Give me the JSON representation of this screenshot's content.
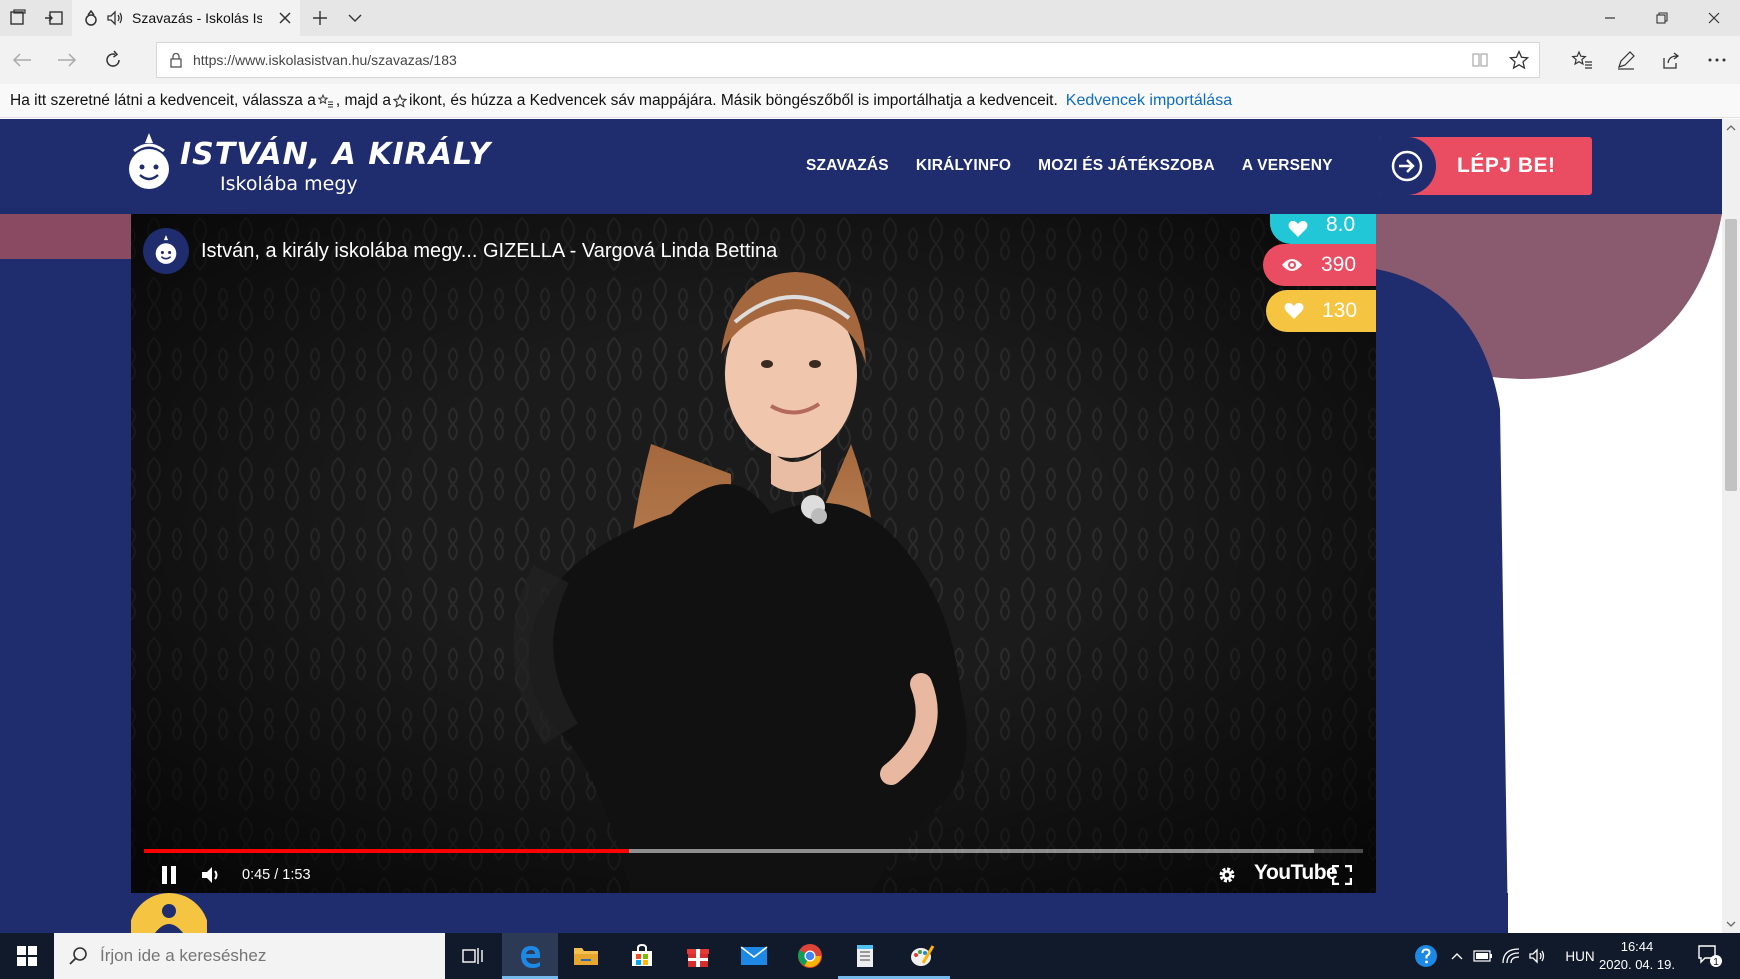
{
  "browser": {
    "tab_title": "Szavazás - Iskolás Is",
    "url": "https://www.iskolasistvan.hu/szavazas/183",
    "favorites_hint_a": "Ha itt szeretné látni a kedvenceit, válassza a ",
    "favorites_hint_b": " , majd a ",
    "favorites_hint_c": " ikont, és húzza a Kedvencek sáv mappájára. Másik böngészőből is importálhatja a kedvenceit.",
    "favorites_import_link": "Kedvencek importálása"
  },
  "site": {
    "logo_line1": "ISTVÁN, A KIRÁLY",
    "logo_line2": "Iskolába megy",
    "nav": [
      "SZAVAZÁS",
      "KIRÁLYINFO",
      "MOZI ÉS JÁTÉKSZOBA",
      "A VERSENY"
    ],
    "login_label": "LÉPJ BE!"
  },
  "video": {
    "title": "István, a király iskolába megy... GIZELLA - Vargová Linda Bettina",
    "time_current": "0:45",
    "time_total": "1:53",
    "time_readout": "0:45 / 1:53",
    "progress_fraction": 0.398,
    "buffer_fraction": 0.96,
    "brand_label": "YouTube"
  },
  "stats": {
    "rating": "8.0",
    "views": "390",
    "likes": "130"
  },
  "taskbar": {
    "search_placeholder": "Írjon ide a kereséshez",
    "language": "HUN",
    "time": "16:44",
    "date": "2020. 04. 19.",
    "notification_count": "1"
  },
  "colors": {
    "site_navy": "#1f2c6d",
    "login_red": "#ea4d62",
    "rating_cyan": "#22c7d7",
    "likes_yellow": "#f5c542",
    "decor_mauve": "#8a5a6e",
    "progress_red": "#ff0000"
  },
  "icons": {
    "tab_audio": "speaker-icon",
    "rating": "heart-icon",
    "views": "eye-icon",
    "likes": "heart-icon",
    "login": "arrow-right-circle-icon"
  }
}
